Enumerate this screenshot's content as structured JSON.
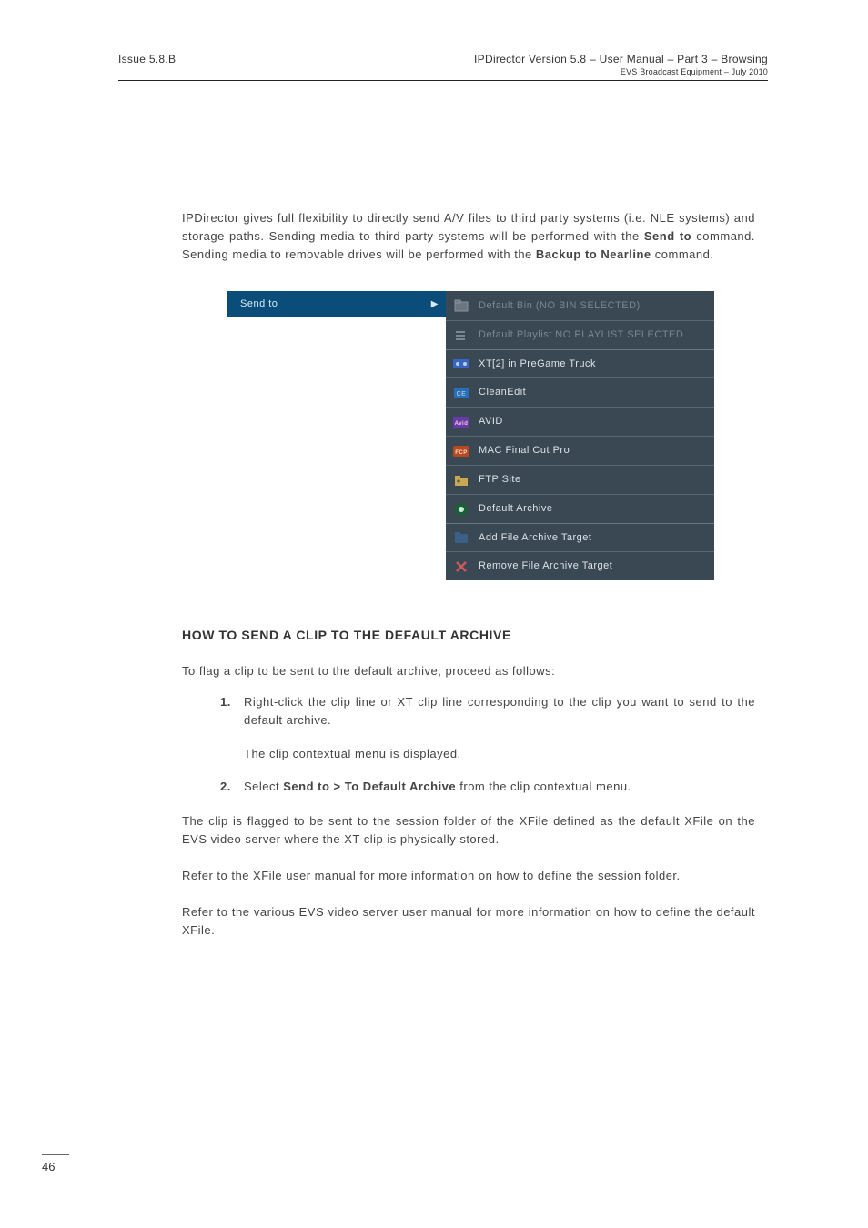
{
  "header": {
    "left": "Issue 5.8.B",
    "right_line1": "IPDirector Version 5.8 – User Manual – Part 3 – Browsing",
    "right_line2": "EVS Broadcast Equipment – July 2010"
  },
  "section": {
    "number": "",
    "title": ""
  },
  "para1_a": "IPDirector gives full flexibility to directly send A/V files to third party systems (i.e. NLE systems) and storage paths. Sending media to third party systems will be performed with the ",
  "para1_b": " command. Sending media to removable drives will be performed with the ",
  "para1_c": " command.",
  "bold_sendto": "Send to",
  "bold_backup": "Backup to Nearline",
  "screenshot": {
    "left_label": "Send to",
    "items": [
      {
        "label": "Default Bin (NO BIN SELECTED)",
        "disabled": true,
        "icon": "bin"
      },
      {
        "label": "Default Playlist NO PLAYLIST SELECTED",
        "disabled": true,
        "icon": "playlist"
      },
      {
        "label": "XT[2] in PreGame Truck",
        "disabled": false,
        "icon": "xt"
      },
      {
        "label": "CleanEdit",
        "disabled": false,
        "icon": "ce"
      },
      {
        "label": "AVID",
        "disabled": false,
        "icon": "avid"
      },
      {
        "label": "MAC Final Cut Pro",
        "disabled": false,
        "icon": "fcp"
      },
      {
        "label": "FTP Site",
        "disabled": false,
        "icon": "ftp"
      },
      {
        "label": "Default Archive",
        "disabled": false,
        "icon": "archive"
      },
      {
        "label": "Add File Archive Target",
        "disabled": false,
        "icon": "add"
      },
      {
        "label": "Remove File Archive Target",
        "disabled": false,
        "icon": "remove"
      }
    ]
  },
  "subsection_title": "HOW TO SEND A CLIP TO THE DEFAULT ARCHIVE",
  "para2": "To flag a clip to be sent to the default archive, proceed as follows:",
  "steps": [
    {
      "num": "1.",
      "body_a": "Right-click the clip line or XT clip line corresponding to the clip you want to send to the default archive.",
      "sub": "The clip contextual menu is displayed."
    },
    {
      "num": "2.",
      "body_a": "Select ",
      "bold": "Send to > To Default Archive",
      "body_b": " from the clip contextual menu."
    }
  ],
  "para3": "The clip is flagged to be sent to the session folder of the XFile defined as the default XFile on the EVS video server where the XT clip is physically stored.",
  "para4": "Refer to the XFile user manual for more information on how to define the session folder.",
  "para5": "Refer to the various EVS video server user manual for more information on how to define the default XFile.",
  "page_number": "46"
}
